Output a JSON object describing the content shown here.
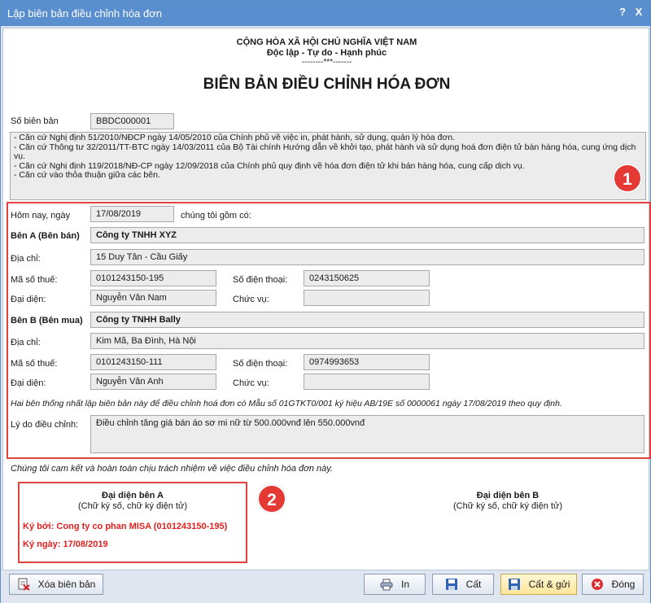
{
  "window": {
    "title": "Lập biên bản điều chỉnh hóa đơn",
    "help_label": "?",
    "close_label": "X"
  },
  "header": {
    "line1": "CỘNG HÒA XÃ HỘI CHỦ NGHĨA VIỆT NAM",
    "line2": "Độc lập - Tự do - Hạnh phúc",
    "line3": "--------***-------",
    "doc_title": "BIÊN BẢN ĐIỀU CHỈNH HÓA ĐƠN"
  },
  "record": {
    "number_label": "Số biên bản",
    "number_value": "BBDC000001"
  },
  "legal_basis": [
    "- Căn cứ Nghị định 51/2010/NĐCP ngày 14/05/2010 của Chính phủ về việc in, phát hành, sử dụng, quản lý hóa đơn.",
    "- Căn cứ Thông tư 32/2011/TT-BTC ngày 14/03/2011 của Bộ Tài chính Hướng dẫn về khởi tạo, phát hành và sử dụng hoá đơn điện tử bán hàng hóa, cung ứng dịch vụ.",
    "- Căn cứ Nghị định 119/2018/NĐ-CP ngày 12/09/2018 của Chính phủ quy định về hóa đơn điện tử khi bán hàng hóa, cung cấp dịch vụ.",
    "- Căn cứ vào thỏa thuận giữa các bên."
  ],
  "badges": {
    "one": "1",
    "two": "2"
  },
  "form": {
    "date_label": "Hôm nay, ngày",
    "date_value": "17/08/2019",
    "parties_suffix": "chúng tôi gồm có:",
    "party_a": {
      "heading": "Bên A (Bên bán)",
      "name": "Công ty TNHH XYZ",
      "address_label": "Địa chỉ:",
      "address": "15 Duy Tân - Cầu Giấy",
      "tax_label": "Mã số thuế:",
      "tax": "0101243150-195",
      "phone_label": "Số điện thoại:",
      "phone": "0243150625",
      "rep_label": "Đại diện:",
      "rep": "Nguyễn Văn Nam",
      "position_label": "Chức vụ:",
      "position": ""
    },
    "party_b": {
      "heading": "Bên B (Bên mua)",
      "name": "Công ty TNHH Bally",
      "address_label": "Địa chỉ:",
      "address": "Kim Mã, Ba Đình, Hà Nội",
      "tax_label": "Mã số thuế:",
      "tax": "0101243150-111",
      "phone_label": "Số điện thoại:",
      "phone": "0974993653",
      "rep_label": "Đại diện:",
      "rep": "Nguyễn Văn Anh",
      "position_label": "Chức vụ:",
      "position": ""
    },
    "agreement": "Hai bên thống nhất lập biên bản này để điều chỉnh hoá đơn có Mẫu số 01GTKT0/001 ký hiệu AB/19E số 0000061 ngày 17/08/2019 theo quy định.",
    "reason_label": "Lý do điều chỉnh:",
    "reason": "Điều chỉnh tăng giá bán áo sơ mi nữ từ 500.000vnđ lên 550.000vnđ"
  },
  "commitment": "Chúng tôi cam kết và hoàn toàn chịu trách nhiệm về việc điều chỉnh hóa đơn này.",
  "signatures": {
    "a_title": "Đại diện bên A",
    "a_sub": "(Chữ ký số, chữ ký điện tử)",
    "a_signed_by": "Ký bởi: Cong ty co phan MISA (0101243150-195)",
    "a_signed_date": "Ký ngày: 17/08/2019",
    "b_title": "Đại diện bên B",
    "b_sub": "(Chữ ký số, chữ ký điện tử)"
  },
  "buttons": {
    "delete": "Xóa biên bản",
    "print": "In",
    "save": "Cất",
    "save_send": "Cất & gửi",
    "close": "Đóng"
  },
  "colors": {
    "accent_red": "#e0423c",
    "title_bar": "#5a8fcf",
    "highlight_button": "#ffe69a"
  }
}
